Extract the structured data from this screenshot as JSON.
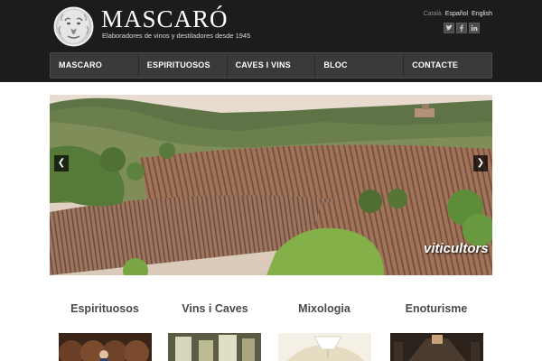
{
  "header": {
    "brand": "MASCARÓ",
    "tagline": "Elaboradores de vinos y destiladores desde 1945",
    "logo_icon": "lion-head-emblem",
    "languages": [
      {
        "label": "Català",
        "active": false
      },
      {
        "label": "Español",
        "active": true
      },
      {
        "label": "English",
        "active": true
      }
    ],
    "social": [
      {
        "icon": "twitter-icon"
      },
      {
        "icon": "facebook-icon"
      },
      {
        "icon": "linkedin-icon"
      }
    ]
  },
  "nav": {
    "items": [
      "MASCARO",
      "ESPIRITUOSOS",
      "CAVES I VINS",
      "BLOC",
      "CONTACTE"
    ]
  },
  "slider": {
    "caption": "viticultors",
    "prev_icon": "chevron-left-icon",
    "next_icon": "chevron-right-icon"
  },
  "categories": [
    {
      "title": "Espirituosos"
    },
    {
      "title": "Vins i Caves"
    },
    {
      "title": "Mixologia"
    },
    {
      "title": "Enoturisme"
    }
  ],
  "colors": {
    "header_bg": "#1c1c1c",
    "nav_bg": "#3a3a3a",
    "category_title": "#4a4a4a"
  }
}
